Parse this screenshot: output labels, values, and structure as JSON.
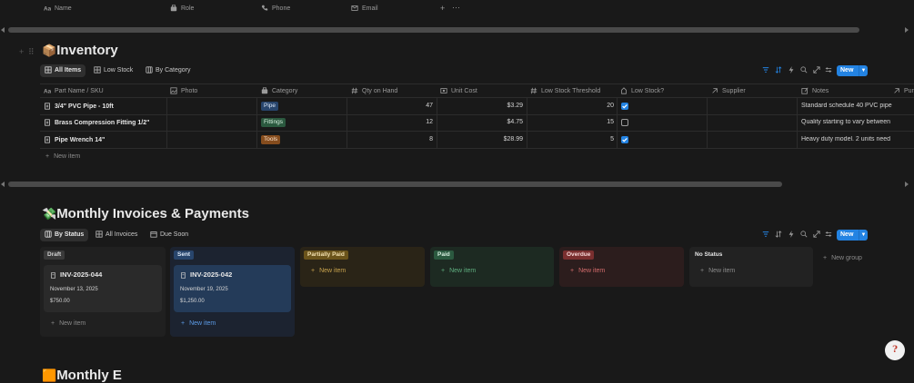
{
  "top_columns": {
    "name": "Name",
    "role": "Role",
    "phone": "Phone",
    "email": "Email"
  },
  "inventory": {
    "emoji": "📦",
    "title": "Inventory",
    "tabs": [
      "All Items",
      "Low Stock",
      "By Category"
    ],
    "new_label": "New",
    "columns": [
      "Part Name / SKU",
      "Photo",
      "Category",
      "Qty on Hand",
      "Unit Cost",
      "Low Stock Threshold",
      "Low Stock?",
      "Supplier",
      "Notes",
      "Pur"
    ],
    "rows": [
      {
        "name": "3/4\" PVC Pipe - 10ft",
        "category": "Pipe",
        "qty": "47",
        "cost": "$3.29",
        "threshold": "20",
        "low": true,
        "notes": "Standard schedule 40 PVC pipe"
      },
      {
        "name": "Brass Compression Fitting 1/2\"",
        "category": "Fittings",
        "qty": "12",
        "cost": "$4.75",
        "threshold": "15",
        "low": false,
        "notes": "Quality starting to vary between"
      },
      {
        "name": "Pipe Wrench 14\"",
        "category": "Tools",
        "qty": "8",
        "cost": "$28.99",
        "threshold": "5",
        "low": true,
        "notes": "Heavy duty model. 2 units need"
      }
    ],
    "new_item": "New item",
    "colors": {
      "pipe": "#28456c",
      "fittings": "#2b593f",
      "tools": "#854c1d"
    }
  },
  "invoices": {
    "emoji": "💸",
    "title": "Monthly Invoices & Payments",
    "tabs": [
      "By Status",
      "All Invoices",
      "Due Soon"
    ],
    "new_label": "New",
    "groups": [
      {
        "label": "Draft",
        "cards": [
          {
            "title": "INV-2025-044",
            "date": "November 13, 2025",
            "amount": "$750.00"
          }
        ],
        "new_item": "New item"
      },
      {
        "label": "Sent",
        "cards": [
          {
            "title": "INV-2025-042",
            "date": "November 19, 2025",
            "amount": "$1,250.00"
          }
        ],
        "new_item": "New item"
      },
      {
        "label": "Partially Paid",
        "cards": [],
        "new_item": "New item"
      },
      {
        "label": "Paid",
        "cards": [],
        "new_item": "New item"
      },
      {
        "label": "Overdue",
        "cards": [],
        "new_item": "New item"
      },
      {
        "label": "No Status",
        "cards": [],
        "new_item": "New item"
      }
    ],
    "new_group": "New group"
  },
  "next_section": {
    "emoji": "🟧",
    "title": "Monthly E"
  }
}
